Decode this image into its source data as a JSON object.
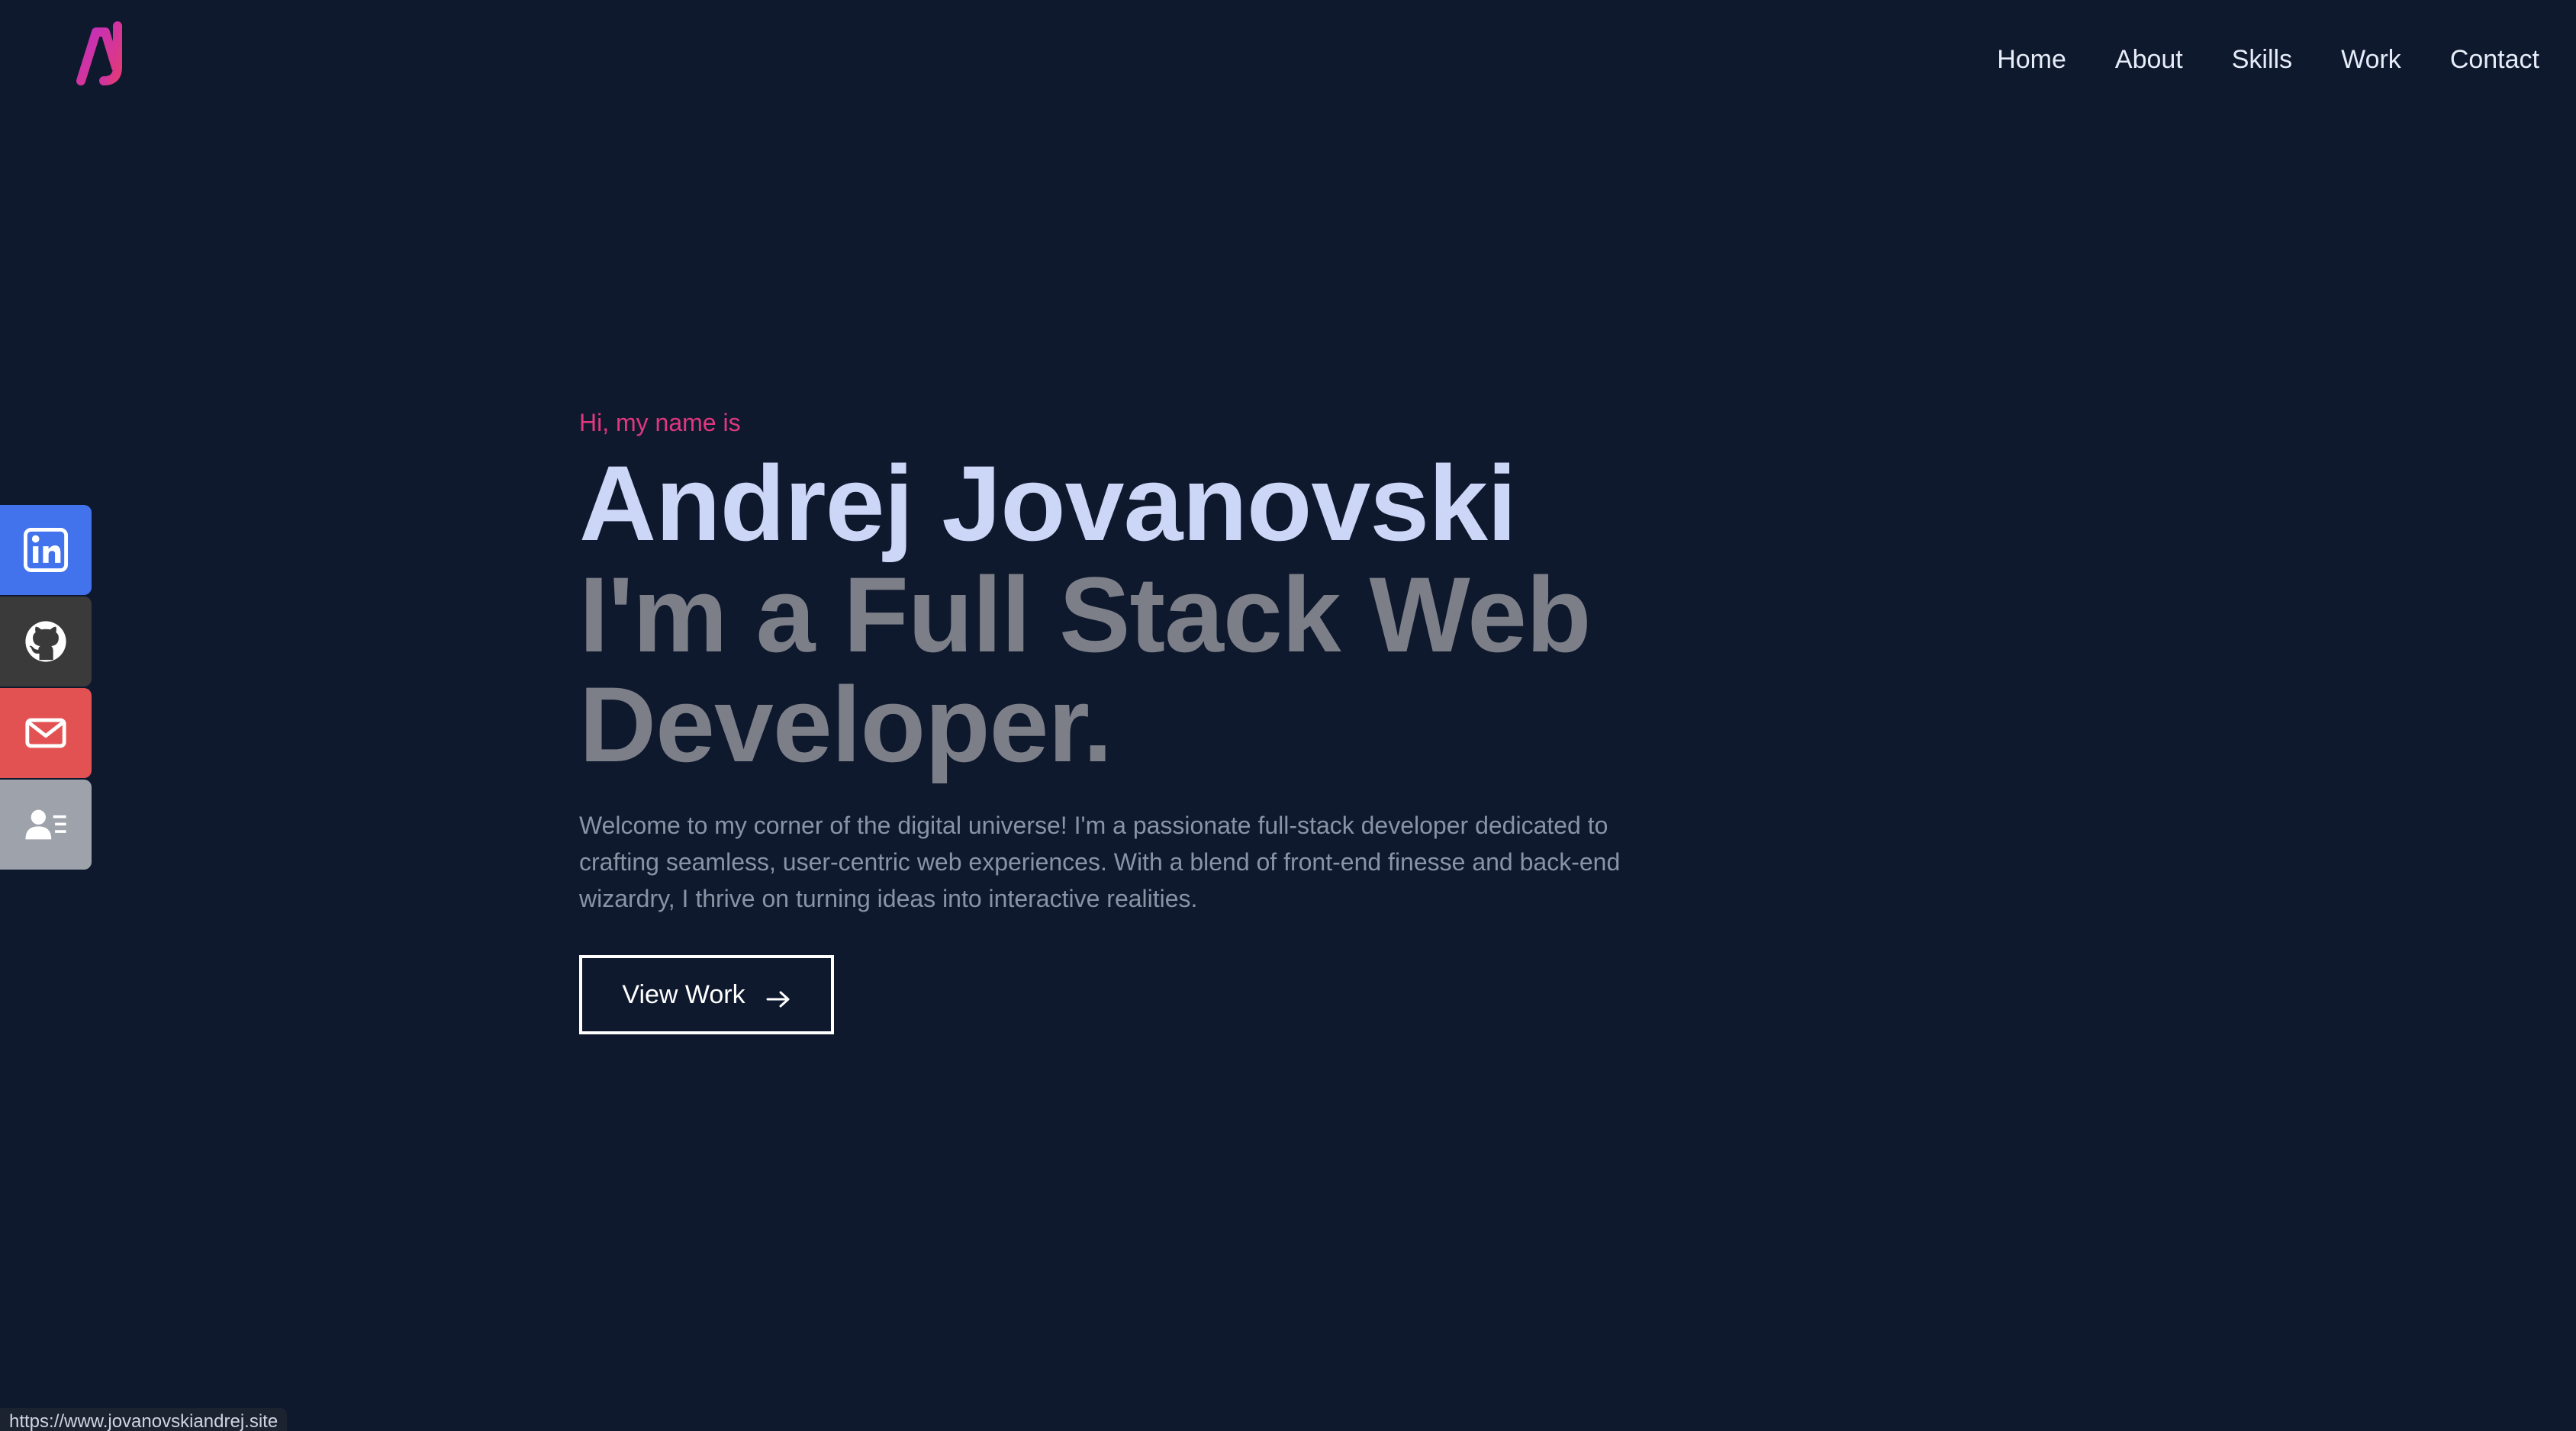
{
  "logo": {
    "icon": "aj-monogram-logo",
    "color": "#d43a8f"
  },
  "nav": {
    "items": [
      {
        "label": "Home"
      },
      {
        "label": "About"
      },
      {
        "label": "Skills"
      },
      {
        "label": "Work"
      },
      {
        "label": "Contact"
      }
    ]
  },
  "hero": {
    "greeting": "Hi, my name is",
    "name": "Andrej Jovanovski",
    "role": "I'm a Full Stack Web Developer.",
    "intro": "Welcome to my corner of the digital universe! I'm a passionate full-stack developer dedicated to crafting seamless, user-centric web experiences. With a blend of front-end finesse and back-end wizardry, I thrive on turning ideas into interactive realities.",
    "cta_label": "View Work"
  },
  "social": [
    {
      "icon": "linkedin-icon",
      "color": "#4272ec"
    },
    {
      "icon": "github-icon",
      "color": "#3a3a3a"
    },
    {
      "icon": "mail-icon",
      "color": "#e35252"
    },
    {
      "icon": "resume-icon",
      "color": "#9ea2ab"
    }
  ],
  "status_bar": {
    "url": "https://www.jovanovskiandrej.site"
  },
  "colors": {
    "background": "#0f192e",
    "accent": "#e0377f",
    "name": "#ccd6f6",
    "role": "#7c7f88",
    "body": "#8a93a6"
  }
}
